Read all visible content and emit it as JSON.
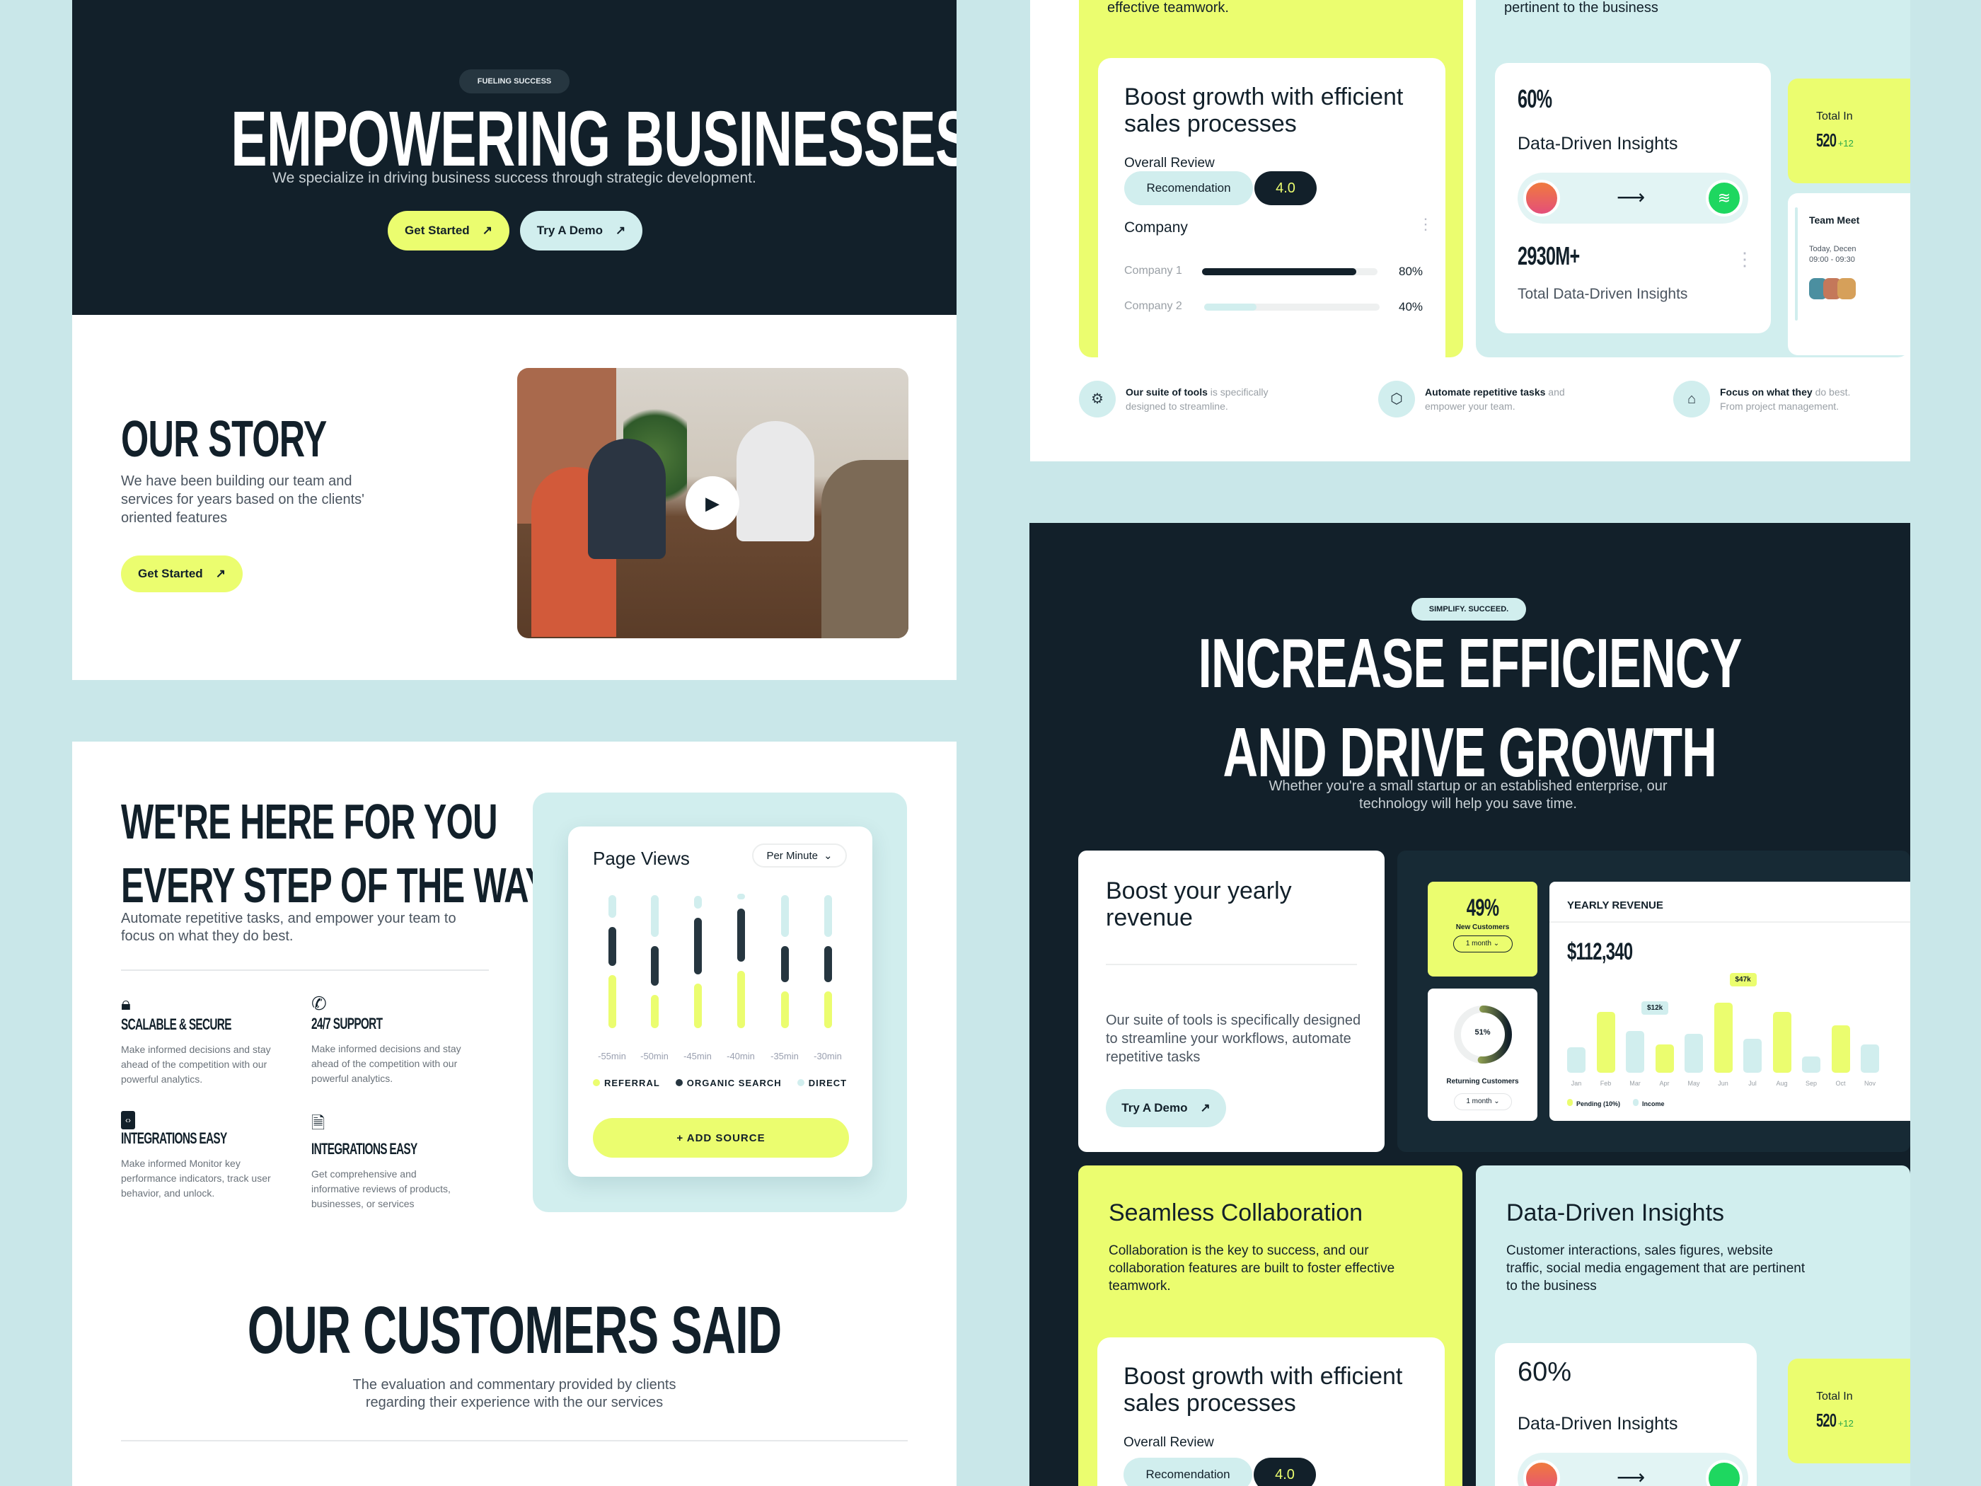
{
  "hero": {
    "badge": "FUELING SUCCESS",
    "title": "EMPOWERING BUSINESSES",
    "subtitle": "We specialize in driving business success through strategic development.",
    "primary_button": "Get Started",
    "secondary_button": "Try A Demo"
  },
  "story": {
    "title": "OUR STORY",
    "text": "We have been building our team and services for years based on the clients' oriented features",
    "button": "Get Started"
  },
  "support": {
    "title_line1": "WE'RE HERE FOR YOU",
    "title_line2": "EVERY STEP OF THE WAY",
    "text": "Automate repetitive tasks, and empower your team to focus on what they do best.",
    "features": [
      {
        "icon": "lock-icon",
        "title": "SCALABLE & SECURE",
        "text": "Make informed decisions and stay ahead of the competition with our powerful analytics."
      },
      {
        "icon": "phone-support-icon",
        "title": "24/7 SUPPORT",
        "text": "Make informed decisions and stay ahead of the competition with our powerful analytics."
      },
      {
        "icon": "code-clipboard-icon",
        "title": "INTEGRATIONS EASY",
        "text": "Make informed Monitor key performance indicators, track user behavior, and unlock."
      },
      {
        "icon": "document-spark-icon",
        "title": "INTEGRATIONS EASY",
        "text": "Get comprehensive and informative reviews of products, businesses, or services"
      }
    ]
  },
  "page_views": {
    "title": "Page Views",
    "dropdown": "Per Minute",
    "add_source": "+ ADD SOURCE"
  },
  "chart_data": [
    {
      "type": "bar",
      "title": "Page Views",
      "categories": [
        "-55min",
        "-50min",
        "-45min",
        "-40min",
        "-35min",
        "-30min"
      ],
      "series": [
        {
          "name": "REFERRAL",
          "color": "#ebfd6f",
          "values": [
            225,
            142,
            188,
            242,
            155,
            155
          ]
        },
        {
          "name": "ORGANIC SEARCH",
          "color": "#263640",
          "values": [
            165,
            168,
            240,
            225,
            155,
            155
          ]
        },
        {
          "name": "DIRECT",
          "color": "#d1eeee",
          "values": [
            95,
            175,
            55,
            25,
            175,
            175
          ]
        }
      ]
    },
    {
      "type": "bar",
      "title": "YEARLY REVENUE",
      "categories": [
        "Jan",
        "Feb",
        "Mar",
        "Apr",
        "May",
        "Jun",
        "Jul",
        "Aug",
        "Sep",
        "Oct",
        "Nov"
      ],
      "values": [
        17,
        41,
        28,
        19,
        26,
        47,
        23,
        41,
        11,
        32,
        19
      ],
      "colors": [
        "#d1eeee",
        "#ebfd6f",
        "#d1eeee",
        "#ebfd6f",
        "#d1eeee",
        "#ebfd6f",
        "#d1eeee",
        "#ebfd6f",
        "#d1eeee",
        "#ebfd6f",
        "#d1eeee"
      ],
      "annotations": [
        {
          "category": "Mar",
          "label": "$12k"
        },
        {
          "category": "Jun",
          "label": "$47k"
        }
      ],
      "legend": [
        "Pending (10%)",
        "Income"
      ]
    }
  ],
  "customers": {
    "title": "OUR CUSTOMERS SAID",
    "text": "The evaluation and commentary provided by clients regarding their experience with the our services"
  },
  "sales_card": {
    "top_text": "effective teamwork.",
    "title": "Boost growth with efficient sales processes",
    "review_label": "Overall Review",
    "recommendation": "Recomendation",
    "score": "4.0",
    "company_label": "Company",
    "companies": [
      {
        "name": "Company 1",
        "value": 80,
        "pct": "80%"
      },
      {
        "name": "Company 2",
        "value": 40,
        "pct": "40%"
      }
    ]
  },
  "insights_card": {
    "top_text": "pertinent to the business",
    "percent": "60%",
    "label": "Data-Driven Insights",
    "total": "2930M+",
    "total_label": "Total Data-Driven Insights",
    "side_title": "Total In",
    "side_value": "520",
    "side_delta": "+12",
    "meet_title": "Team Meet",
    "meet_date": "Today, Decen",
    "meet_time": "09:00 - 09:30"
  },
  "features_row": [
    {
      "bold": "Our suite of tools",
      "rest": " is specifically",
      "line2": "designed to streamline."
    },
    {
      "bold": "Automate repetitive tasks",
      "rest": " and",
      "line2": "empower your team."
    },
    {
      "bold": "Focus on what they",
      "rest": " do best.",
      "line2": "From project management."
    }
  ],
  "efficiency": {
    "badge": "SIMPLIFY. SUCCEED.",
    "title_line1": "INCREASE EFFICIENCY",
    "title_line2": "AND DRIVE GROWTH",
    "subtitle": "Whether you're a small startup or an established enterprise, our technology will help you save time.",
    "revenue_card": {
      "title": "Boost your yearly revenue",
      "text": "Our suite of tools is specifically designed to streamline your workflows, automate repetitive tasks",
      "button": "Try A Demo"
    },
    "new_customers": {
      "value": "49%",
      "label": "New Customers",
      "period": "1 month"
    },
    "returning": {
      "value": "51%",
      "label": "Returning Customers",
      "period": "1 month",
      "fraction": 0.51
    },
    "yearly": {
      "title": "YEARLY REVENUE",
      "value": "$112,340"
    },
    "collab": {
      "title": "Seamless Collaboration",
      "text": "Collaboration is the key to success, and our collaboration features are built to foster effective teamwork."
    },
    "insights": {
      "title": "Data-Driven Insights",
      "text": "Customer interactions, sales figures, website traffic, social media engagement that are pertinent to the business"
    }
  },
  "colors": {
    "dark": "#12202a",
    "lime": "#ebfd6f",
    "teal": "#d1eeee",
    "background": "#c9e7e9"
  }
}
